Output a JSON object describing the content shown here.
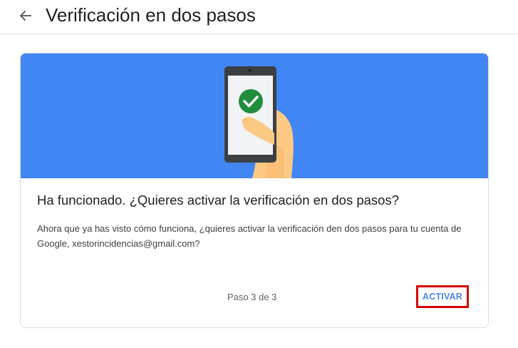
{
  "header": {
    "back_icon": "arrow-back-icon",
    "title": "Verificación en dos pasos"
  },
  "card": {
    "illustration": "phone-in-hand-check-icon",
    "title": "Ha funcionado. ¿Quieres activar la verificación en dos pasos?",
    "description": "Ahora que ya has visto cómo funciona, ¿quieres activar la verificación den dos pasos para tu cuenta de Google, xestorincidencias@gmail.com?",
    "step_text": "Paso 3 de 3",
    "activate_label": "ACTIVAR"
  },
  "colors": {
    "hero_background": "#4285f4",
    "accent": "#4a86e8",
    "success": "#1e8e3e",
    "highlight_border": "#d50000"
  }
}
